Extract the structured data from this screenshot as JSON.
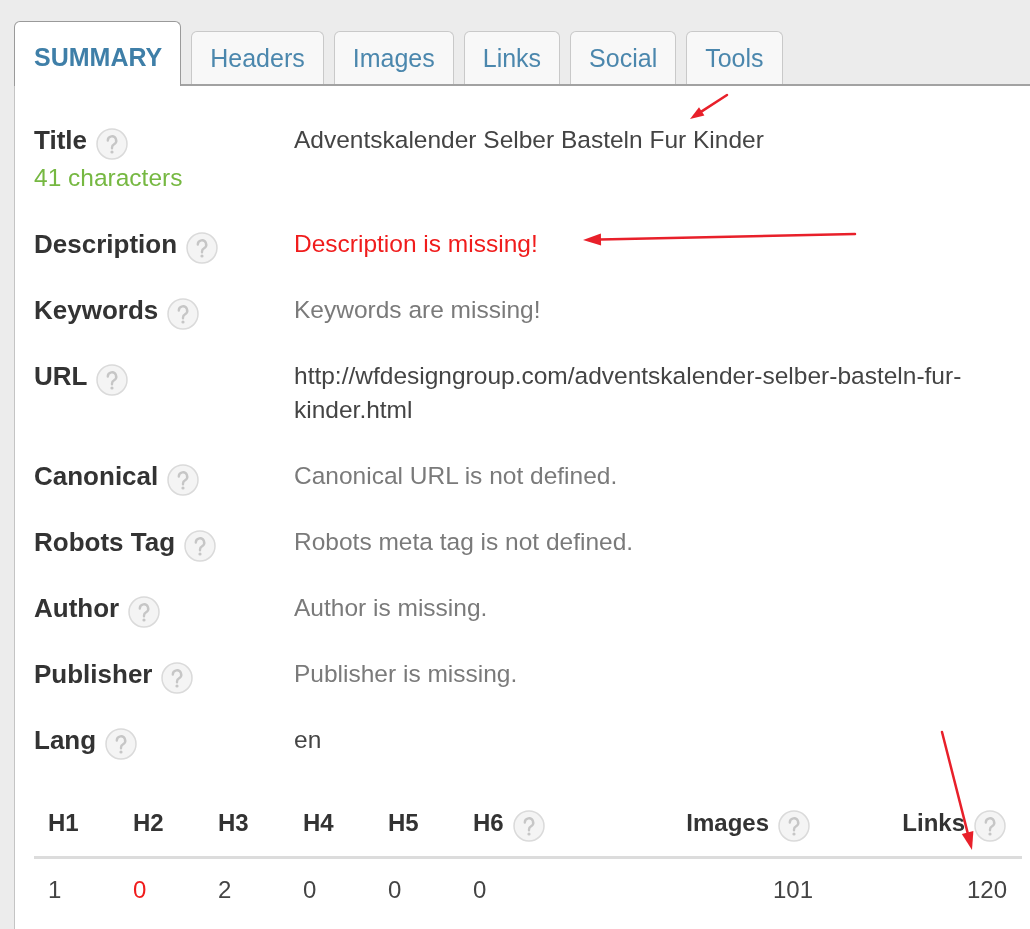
{
  "tabs": [
    {
      "label": "SUMMARY",
      "selected": true
    },
    {
      "label": "Headers",
      "selected": false
    },
    {
      "label": "Images",
      "selected": false
    },
    {
      "label": "Links",
      "selected": false
    },
    {
      "label": "Social",
      "selected": false
    },
    {
      "label": "Tools",
      "selected": false
    }
  ],
  "fields": [
    {
      "label": "Title",
      "help": true,
      "value": "Adventskalender Selber Basteln Fur Kinder",
      "error": false,
      "missing": false,
      "note": "41 characters"
    },
    {
      "label": "Description",
      "help": true,
      "value": "Description is missing!",
      "error": true,
      "missing": true
    },
    {
      "label": "Keywords",
      "help": true,
      "value": "Keywords are missing!",
      "error": false,
      "missing": true
    },
    {
      "label": "URL",
      "help": true,
      "value": "http://wfdesigngroup.com/adventskalender-selber-basteln-fur-kinder.html",
      "error": false,
      "missing": false
    },
    {
      "label": "Canonical",
      "help": true,
      "value": "Canonical URL is not defined.",
      "error": false,
      "missing": true
    },
    {
      "label": "Robots Tag",
      "help": true,
      "value": "Robots meta tag is not defined.",
      "error": false,
      "missing": true
    },
    {
      "label": "Author",
      "help": true,
      "value": "Author is missing.",
      "error": false,
      "missing": true
    },
    {
      "label": "Publisher",
      "help": true,
      "value": "Publisher is missing.",
      "error": false,
      "missing": true
    },
    {
      "label": "Lang",
      "help": true,
      "value": "en",
      "error": false,
      "missing": false
    }
  ],
  "counts_table": {
    "columns": [
      {
        "label": "H1",
        "kind": "heading",
        "help": false
      },
      {
        "label": "H2",
        "kind": "heading",
        "help": false
      },
      {
        "label": "H3",
        "kind": "heading",
        "help": false
      },
      {
        "label": "H4",
        "kind": "heading",
        "help": false
      },
      {
        "label": "H5",
        "kind": "heading",
        "help": false
      },
      {
        "label": "H6",
        "kind": "heading",
        "help": true
      },
      {
        "label": "Images",
        "kind": "total",
        "help": true
      },
      {
        "label": "Links",
        "kind": "total",
        "help": true
      }
    ],
    "values": [
      {
        "text": "1",
        "error": false
      },
      {
        "text": "0",
        "error": true
      },
      {
        "text": "2",
        "error": false
      },
      {
        "text": "0",
        "error": false
      },
      {
        "text": "0",
        "error": false
      },
      {
        "text": "0",
        "error": false
      },
      {
        "text": "101",
        "error": false
      },
      {
        "text": "120",
        "error": false
      }
    ]
  }
}
